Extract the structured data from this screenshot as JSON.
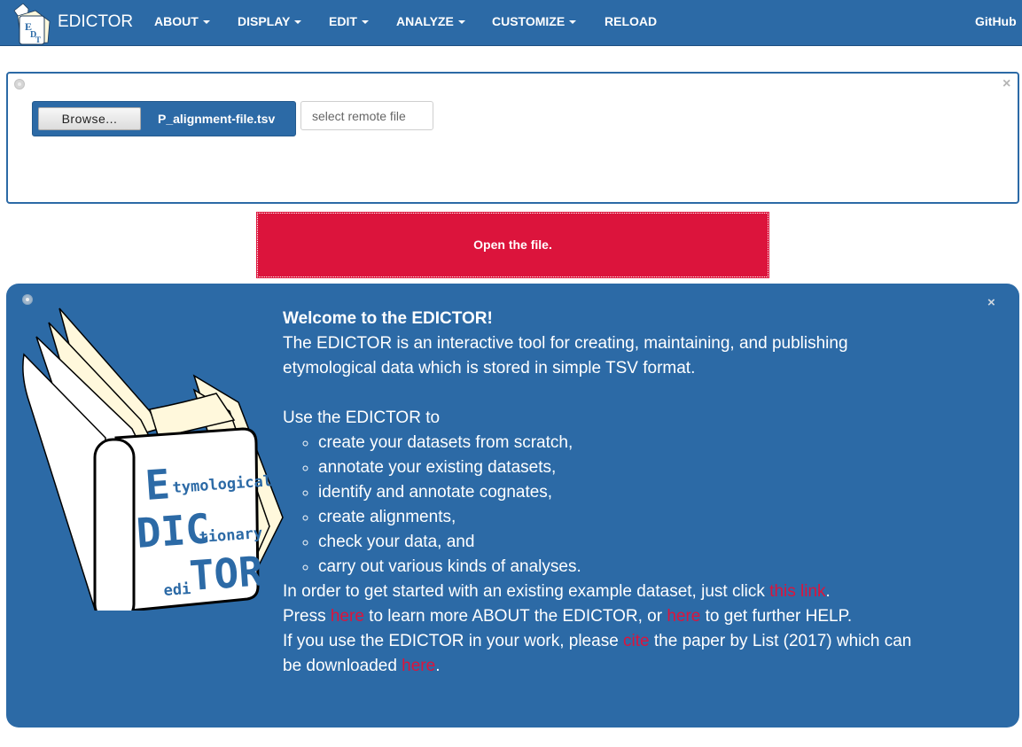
{
  "nav": {
    "brand": "EDICTOR",
    "items": [
      {
        "label": "ABOUT",
        "dropdown": true
      },
      {
        "label": "DISPLAY",
        "dropdown": true
      },
      {
        "label": "EDIT",
        "dropdown": true
      },
      {
        "label": "ANALYZE",
        "dropdown": true
      },
      {
        "label": "CUSTOMIZE",
        "dropdown": true
      },
      {
        "label": "RELOAD",
        "dropdown": false
      }
    ],
    "github": "GitHub"
  },
  "file_panel": {
    "browse_label": "Browse...",
    "file_name": "P_alignment-file.tsv",
    "remote_placeholder": "select remote file",
    "close": "×"
  },
  "open_button": "Open the file.",
  "welcome": {
    "close": "×",
    "logo_text": {
      "line1_big": "E",
      "line1_small": "tymological",
      "line2_big": "DIC",
      "line2_small": "tionary",
      "line3_small": "edi",
      "line3_big": "TOR"
    },
    "title": "Welcome to the EDICTOR!",
    "intro": "The EDICTOR is an interactive tool for creating, maintaining, and publishing etymological data which is stored in simple TSV format.",
    "use_lead": "Use the EDICTOR to",
    "uses": [
      "create your datasets from scratch,",
      "annotate your existing datasets,",
      "identify and annotate cognates,",
      "create alignments,",
      "check your data, and",
      "carry out various kinds of analyses."
    ],
    "line1_pre": "In order to get started with an existing example dataset, just click ",
    "line1_link": "this link",
    "line1_post": ".",
    "line2_pre": "Press ",
    "line2_link1": "here",
    "line2_mid": " to learn more ABOUT the EDICTOR, or ",
    "line2_link2": "here",
    "line2_post": " to get further HELP.",
    "line3_pre": "If you use the EDICTOR in your work, please ",
    "line3_link": "cite",
    "line3_post": " the paper by List (2017) which can be downloaded ",
    "line3_link2": "here",
    "line3_end": "."
  },
  "colors": {
    "primary": "#2c6aa6",
    "accent": "#dc143c"
  }
}
